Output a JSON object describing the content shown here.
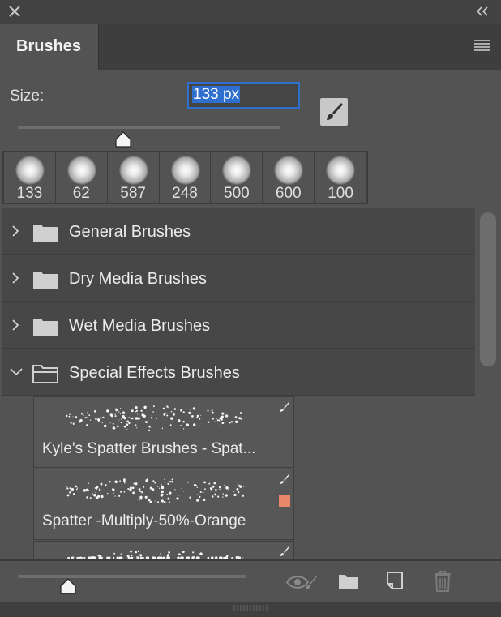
{
  "panel": {
    "tab_label": "Brushes",
    "size_label": "Size:",
    "size_value": "133 px",
    "size_slider_fraction": 0.4,
    "preview_size_fraction": 0.22
  },
  "presets": [
    {
      "size": "133"
    },
    {
      "size": "62"
    },
    {
      "size": "587"
    },
    {
      "size": "248"
    },
    {
      "size": "500"
    },
    {
      "size": "600"
    },
    {
      "size": "100"
    }
  ],
  "groups": [
    {
      "label": "General Brushes",
      "expanded": false
    },
    {
      "label": "Dry Media Brushes",
      "expanded": false
    },
    {
      "label": "Wet Media Brushes",
      "expanded": false
    },
    {
      "label": "Special Effects Brushes",
      "expanded": true
    }
  ],
  "brushes": [
    {
      "label": "Kyle's Spatter Brushes - Spat...",
      "swatch": null
    },
    {
      "label": "Spatter -Multiply-50%-Orange",
      "swatch": "#e8876a"
    },
    {
      "label": "",
      "swatch": null
    }
  ],
  "colors": {
    "accent": "#2f6fcf",
    "panel_bg": "#535353",
    "group_bg": "#474747"
  },
  "icons": {
    "close": "close-icon",
    "collapse": "double-chevron-left-icon",
    "menu": "hamburger-menu-icon",
    "brush_tool": "brush-icon",
    "toggle_preview": "eye-brush-icon",
    "new_group": "folder-icon",
    "new_brush": "new-page-icon",
    "delete": "trash-icon"
  }
}
